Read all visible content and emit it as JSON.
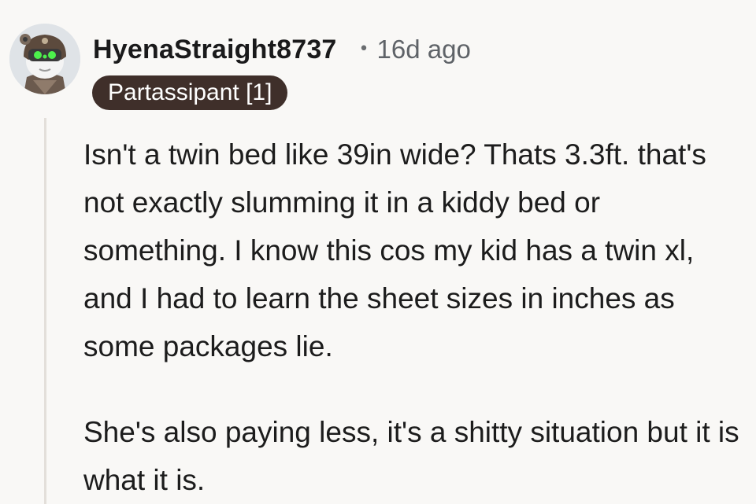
{
  "comment": {
    "username": "HyenaStraight8737",
    "separator": "•",
    "timestamp": "16d ago",
    "flair": "Partassipant [1]",
    "avatar_icon": "user-avatar-icon",
    "colors": {
      "background": "#f9f8f6",
      "flair_background": "#3f2f2a",
      "flair_text": "#ffffff",
      "thread_line": "#e3dfda"
    },
    "paragraphs": [
      "Isn't a twin bed like 39in wide? Thats 3.3ft. that's not exactly slumming it in a kiddy bed or something. I know this cos my kid has a twin xl, and I had to learn the sheet sizes in inches as some packages lie.",
      "She's also paying less, it's a shitty situation but it is what it is."
    ]
  }
}
